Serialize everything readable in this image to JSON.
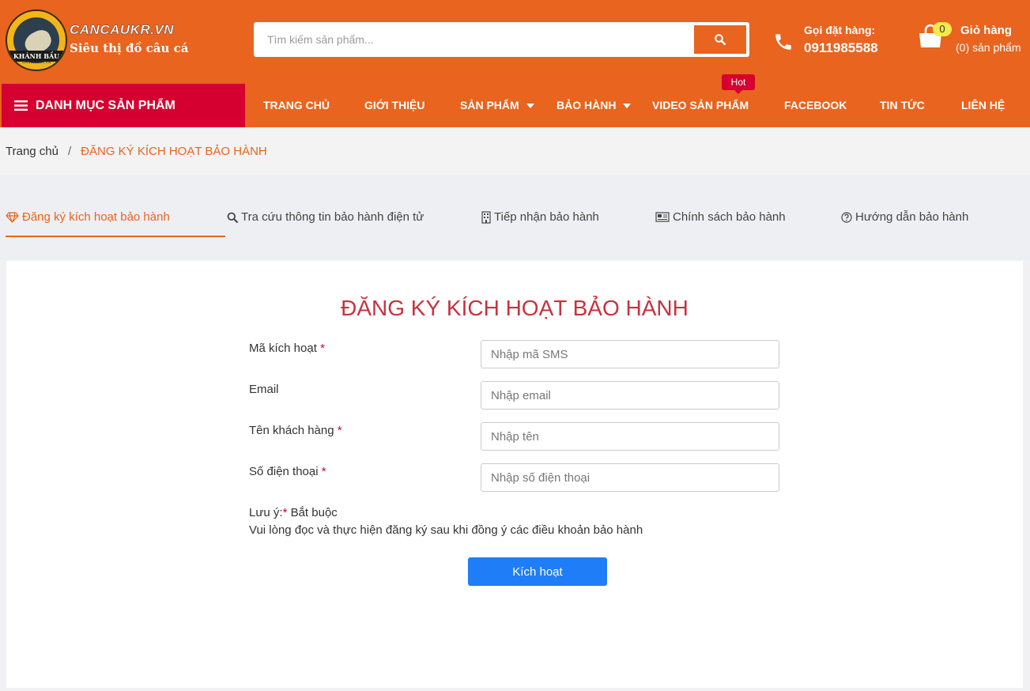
{
  "header": {
    "logo_text": "KHÁNH BẦU",
    "logo_small_text": "CANCAUKR.VN",
    "brand_name": "CANCAUKR.VN",
    "brand_tagline": "Siêu thị đồ câu cá",
    "search_placeholder": "Tìm kiếm sản phẩm...",
    "phone_label": "Gọi đặt hàng:",
    "phone_number": "0911985588",
    "cart_badge": "0",
    "cart_label": "Giỏ hàng",
    "cart_count": "(0) sản phẩm"
  },
  "nav": {
    "category_label": "DANH MỤC SẢN PHẨM",
    "hot_badge": "Hot",
    "items": [
      {
        "label": "TRANG CHỦ"
      },
      {
        "label": "GIỚI THIỆU"
      },
      {
        "label": "SẢN PHẨM"
      },
      {
        "label": "BẢO HÀNH"
      },
      {
        "label": "VIDEO SẢN PHẨM"
      },
      {
        "label": "FACEBOOK"
      },
      {
        "label": "TIN TỨC"
      },
      {
        "label": "LIÊN HỆ"
      }
    ]
  },
  "breadcrumb": {
    "home": "Trang chủ",
    "separator": "/",
    "current": "ĐĂNG KÝ KÍCH HOẠT BẢO HÀNH"
  },
  "tabs": [
    {
      "label": "Đăng ký kích hoạt bảo hành",
      "icon": "diamond-icon",
      "active": true
    },
    {
      "label": "Tra cứu thông tin bảo hành điện tử",
      "icon": "search-icon",
      "active": false
    },
    {
      "label": "Tiếp nhận bảo hành",
      "icon": "building-icon",
      "active": false
    },
    {
      "label": "Chính sách bảo hành",
      "icon": "newspaper-icon",
      "active": false
    },
    {
      "label": "Hướng dẫn bảo hành",
      "icon": "question-circle-icon",
      "active": false
    }
  ],
  "form": {
    "title": "ĐĂNG KÝ KÍCH HOẠT BẢO HÀNH",
    "required_mark": "*",
    "fields": [
      {
        "label": "Mã kích hoạt",
        "required": true,
        "placeholder": "Nhập mã SMS"
      },
      {
        "label": "Email",
        "required": false,
        "placeholder": "Nhập email"
      },
      {
        "label": "Tên khách hàng",
        "required": true,
        "placeholder": "Nhập tên"
      },
      {
        "label": "Số điện thoại",
        "required": true,
        "placeholder": "Nhập số điện thoại"
      }
    ],
    "note_prefix": "Lưu ý:",
    "note_required": "Bắt buộc",
    "note_terms": "Vui lòng đọc và thực hiện đăng ký sau khi đồng ý các điều khoản bảo hành",
    "submit_label": "Kích hoạt"
  },
  "colors": {
    "header_bg": "#e8641f",
    "category_bg": "#d5002f",
    "accent": "#e8641f",
    "title": "#c8323f",
    "button": "#1f7ef7"
  }
}
